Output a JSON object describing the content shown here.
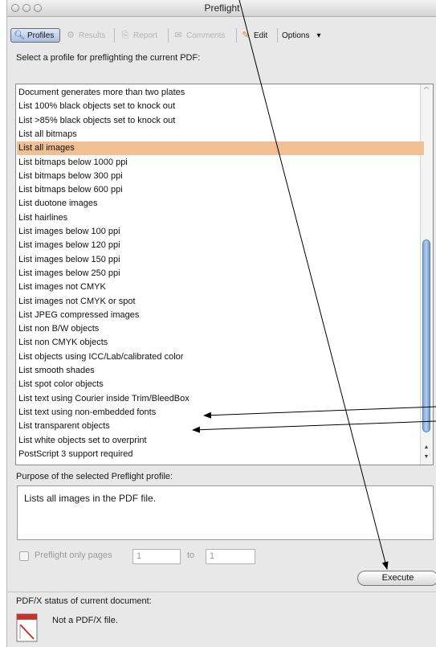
{
  "window": {
    "title": "Preflight"
  },
  "toolbar": {
    "tabs": [
      {
        "label": "Profiles",
        "icon": "profiles-icon",
        "state": "active"
      },
      {
        "label": "Results",
        "icon": "results-icon",
        "state": "disabled"
      },
      {
        "label": "Report",
        "icon": "report-icon",
        "state": "disabled"
      },
      {
        "label": "Comments",
        "icon": "comments-icon",
        "state": "disabled"
      },
      {
        "label": "Edit",
        "icon": "edit-icon",
        "state": "enabled"
      },
      {
        "label": "Options",
        "icon": "dropdown-icon",
        "state": "enabled"
      }
    ],
    "options_arrow": "▾"
  },
  "instruction": "Select a profile for preflighting the current PDF:",
  "profiles": {
    "selected_index": 4,
    "items": [
      "Document generates more than two plates",
      "List 100% black objects set to knock out",
      "List >85% black objects set to knock out",
      "List all bitmaps",
      "List all images",
      "List bitmaps below 1000 ppi",
      "List bitmaps below 300 ppi",
      "List bitmaps below 600 ppi",
      "List duotone images",
      "List hairlines",
      "List images below 100 ppi",
      "List images below 120 ppi",
      "List images below 150 ppi",
      "List images below 250 ppi",
      "List images not CMYK",
      "List images not CMYK or spot",
      "List JPEG compressed images",
      "List non B/W objects",
      "List non CMYK objects",
      "List objects using ICC/Lab/calibrated color",
      "List smooth shades",
      "List spot color objects",
      "List text using Courier inside Trim/BleedBox",
      "List text using non-embedded fonts",
      "List transparent objects",
      "List white objects set to overprint",
      "PostScript 3 support required"
    ]
  },
  "purpose": {
    "label": "Purpose of the selected Preflight profile:",
    "text": "Lists all images in the PDF file."
  },
  "page_range": {
    "label": "Preflight only pages",
    "from": "1",
    "to_label": "to",
    "to": "1",
    "checked": false
  },
  "execute_label": "Execute",
  "pdfx": {
    "label": "PDF/X status of current document:",
    "status": "Not a PDF/X file."
  },
  "colors": {
    "selection": "#f0bf94",
    "active_tab": "#a8bedf",
    "scroll_thumb": "#7fa7d8"
  }
}
